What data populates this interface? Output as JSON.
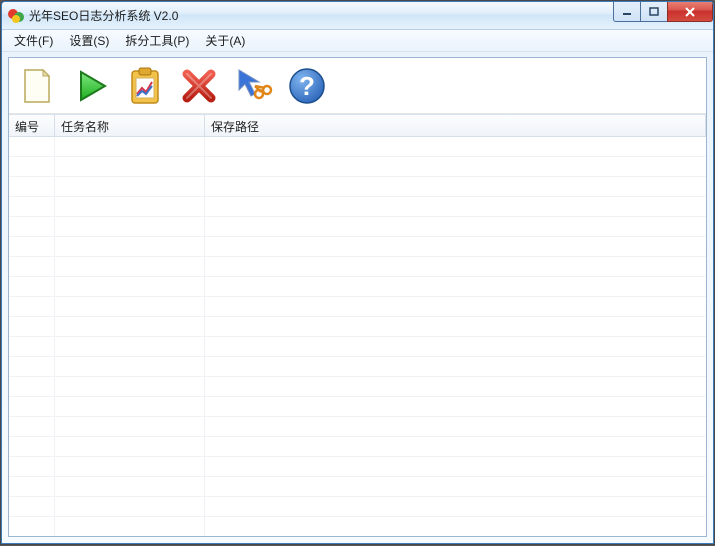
{
  "window": {
    "title": "光年SEO日志分析系统 V2.0"
  },
  "menu": {
    "file": "文件(F)",
    "settings": "设置(S)",
    "split_tool": "拆分工具(P)",
    "about": "关于(A)"
  },
  "toolbar": {
    "new": "new-document",
    "run": "run",
    "report": "report",
    "delete": "delete",
    "split": "split-cursor",
    "help": "help"
  },
  "table": {
    "columns": {
      "id": "编号",
      "task_name": "任务名称",
      "save_path": "保存路径"
    },
    "rows": []
  }
}
